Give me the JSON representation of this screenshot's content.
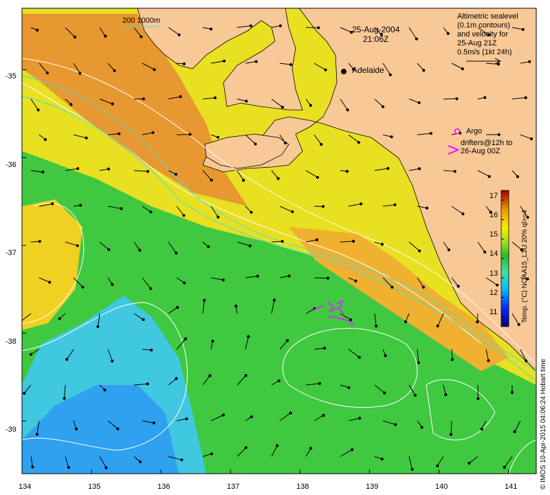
{
  "header": {
    "date": "25-Aug-2004",
    "time": "21:06Z"
  },
  "scale_label": "200  1000m",
  "city": {
    "name": "Adelaide",
    "lon": 138.6,
    "lat": -34.93
  },
  "altimetry_note": {
    "lines": [
      "Altimetric sealevel",
      "(0.1m contours)",
      "and velocity for",
      "25-Aug 21Z",
      "0.5m/s (1kt 24h)"
    ]
  },
  "legend": {
    "argo_label": "Argo",
    "drifters_label_1": "drifters@12h to",
    "drifters_label_2": "26-Aug 00Z",
    "argo_color": "#ff00ff",
    "drifter_color": "#cc33ff"
  },
  "colorbar": {
    "title": "Temp. (°C) NOAA15_L3U 20% ql>=4",
    "min": 10.5,
    "max": 17.5,
    "ticks": [
      "17",
      "16",
      "15",
      "14",
      "13",
      "12",
      "11"
    ]
  },
  "credit": "© IMOS 10-Apr-2015 04:06:24 Hobart time",
  "axes": {
    "x_ticks": [
      "134",
      "135",
      "136",
      "137",
      "138",
      "139",
      "140",
      "141"
    ],
    "y_ticks": [
      "-35",
      "-36",
      "-37",
      "-38",
      "-39"
    ],
    "xlim": [
      134,
      141.4
    ],
    "ylim": [
      -39.6,
      -34.3
    ]
  },
  "colors": {
    "land": "#f8c896",
    "contour": "#ffffff",
    "isobath": "#40e0e0",
    "arrow": "#000000"
  }
}
